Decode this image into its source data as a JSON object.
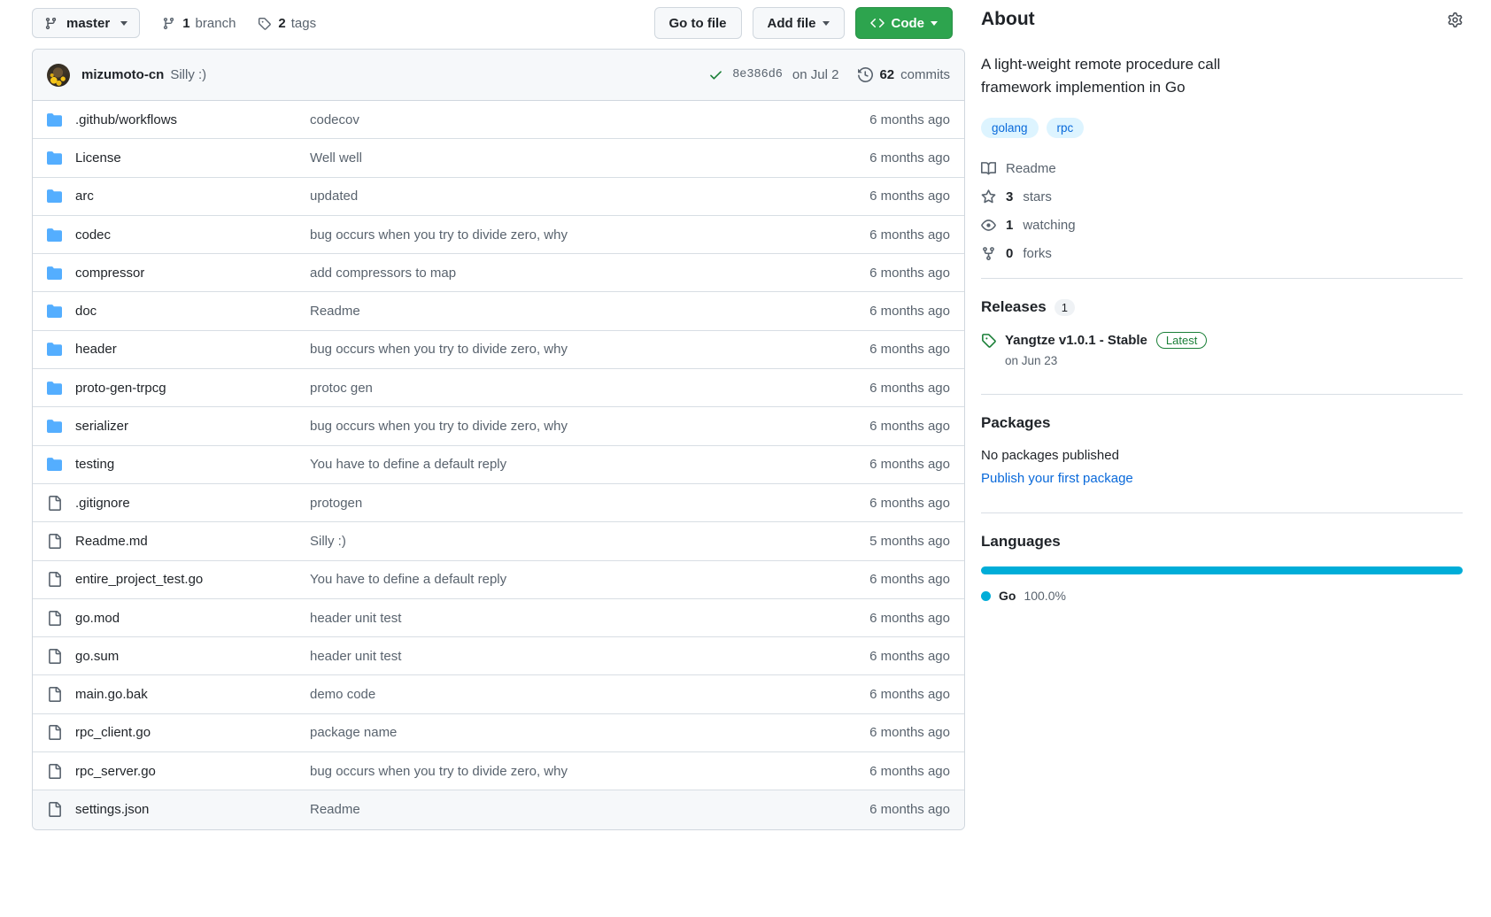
{
  "toolbar": {
    "branch_name": "master",
    "branch_icon": "git-branch-icon",
    "branches_count": "1",
    "branches_label": "branch",
    "tags_count": "2",
    "tags_label": "tags",
    "go_to_file": "Go to file",
    "add_file": "Add file",
    "code": "Code"
  },
  "commit_bar": {
    "author": "mizumoto-cn",
    "message": "Silly :)",
    "sha": "8e386d6",
    "date": "on Jul 2",
    "commits_count": "62",
    "commits_label": "commits"
  },
  "files": [
    {
      "type": "folder",
      "name": ".github/workflows",
      "message": "codecov",
      "age": "6 months ago"
    },
    {
      "type": "folder",
      "name": "License",
      "message": "Well well",
      "age": "6 months ago"
    },
    {
      "type": "folder",
      "name": "arc",
      "message": "updated",
      "age": "6 months ago"
    },
    {
      "type": "folder",
      "name": "codec",
      "message": "bug occurs when you try to divide zero, why",
      "age": "6 months ago"
    },
    {
      "type": "folder",
      "name": "compressor",
      "message": "add compressors to map",
      "age": "6 months ago"
    },
    {
      "type": "folder",
      "name": "doc",
      "message": "Readme",
      "age": "6 months ago"
    },
    {
      "type": "folder",
      "name": "header",
      "message": "bug occurs when you try to divide zero, why",
      "age": "6 months ago"
    },
    {
      "type": "folder",
      "name": "proto-gen-trpcg",
      "message": "protoc gen",
      "age": "6 months ago"
    },
    {
      "type": "folder",
      "name": "serializer",
      "message": "bug occurs when you try to divide zero, why",
      "age": "6 months ago"
    },
    {
      "type": "folder",
      "name": "testing",
      "message": "You have to define a default reply",
      "age": "6 months ago"
    },
    {
      "type": "file",
      "name": ".gitignore",
      "message": "protogen",
      "age": "6 months ago"
    },
    {
      "type": "file",
      "name": "Readme.md",
      "message": "Silly :)",
      "age": "5 months ago"
    },
    {
      "type": "file",
      "name": "entire_project_test.go",
      "message": "You have to define a default reply",
      "age": "6 months ago"
    },
    {
      "type": "file",
      "name": "go.mod",
      "message": "header unit test",
      "age": "6 months ago"
    },
    {
      "type": "file",
      "name": "go.sum",
      "message": "header unit test",
      "age": "6 months ago"
    },
    {
      "type": "file",
      "name": "main.go.bak",
      "message": "demo code",
      "age": "6 months ago"
    },
    {
      "type": "file",
      "name": "rpc_client.go",
      "message": "package name",
      "age": "6 months ago"
    },
    {
      "type": "file",
      "name": "rpc_server.go",
      "message": "bug occurs when you try to divide zero, why",
      "age": "6 months ago"
    },
    {
      "type": "file",
      "name": "settings.json",
      "message": "Readme",
      "age": "6 months ago"
    }
  ],
  "about": {
    "title": "About",
    "settings_icon": "gear-icon",
    "description": "A light-weight remote procedure call framework implemention in Go",
    "topics": [
      "golang",
      "rpc"
    ],
    "stats": [
      {
        "icon": "book-icon",
        "value": "",
        "label": "Readme"
      },
      {
        "icon": "star-icon",
        "value": "3",
        "label": "stars"
      },
      {
        "icon": "eye-icon",
        "value": "1",
        "label": "watching"
      },
      {
        "icon": "fork-icon",
        "value": "0",
        "label": "forks"
      }
    ]
  },
  "releases": {
    "title": "Releases",
    "count": "1",
    "name": "Yangtze v1.0.1 - Stable",
    "badge": "Latest",
    "date": "on Jun 23"
  },
  "packages": {
    "title": "Packages",
    "empty_text": "No packages published",
    "publish_link": "Publish your first package"
  },
  "languages": {
    "title": "Languages",
    "items": [
      {
        "name": "Go",
        "percent": "100.0%",
        "width": 100,
        "color": "#00add8"
      }
    ]
  },
  "colors": {
    "accent_green": "#2da44e",
    "link_blue": "#0969da",
    "folder_blue": "#54aeff",
    "go_cyan": "#00add8",
    "success_green": "#1a7f37"
  }
}
